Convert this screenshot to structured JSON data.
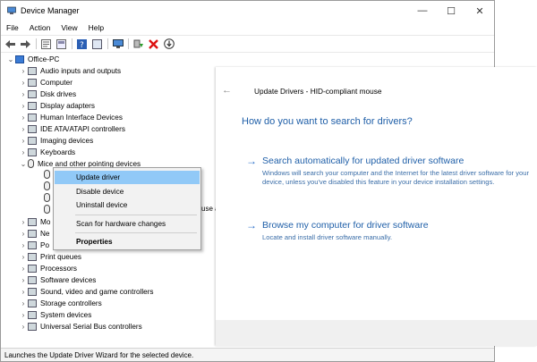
{
  "window": {
    "title": "Device Manager",
    "controls": [
      "—",
      "☐",
      "✕"
    ]
  },
  "menubar": [
    "File",
    "Action",
    "View",
    "Help"
  ],
  "toolbar_icons": [
    "back-icon",
    "forward-icon",
    "properties-icon",
    "show-hide-icon",
    "help-icon",
    "monitor-icon",
    "update-driver-icon",
    "uninstall-icon",
    "download-icon"
  ],
  "tree": {
    "root": "Office-PC",
    "items": [
      "Audio inputs and outputs",
      "Computer",
      "Disk drives",
      "Display adapters",
      "Human Interface Devices",
      "IDE ATA/ATAPI controllers",
      "Imaging devices",
      "Keyboards",
      "Mice and other pointing devices"
    ],
    "partial_rows": [
      "Mo",
      "Ne",
      "Po"
    ],
    "partial_right": "use a",
    "items_after": [
      "Print queues",
      "Processors",
      "Software devices",
      "Sound, video and game controllers",
      "Storage controllers",
      "System devices",
      "Universal Serial Bus controllers"
    ]
  },
  "context_menu": {
    "update": "Update driver",
    "disable": "Disable device",
    "uninstall": "Uninstall device",
    "scan": "Scan for hardware changes",
    "properties": "Properties"
  },
  "status": "Launches the Update Driver Wizard for the selected device.",
  "update_panel": {
    "title": "Update Drivers - HID-compliant mouse",
    "heading": "How do you want to search for drivers?",
    "option1": {
      "title": "Search automatically for updated driver software",
      "desc": "Windows will search your computer and the Internet for the latest driver software for your device, unless you've disabled this feature in your device installation settings."
    },
    "option2": {
      "title": "Browse my computer for driver software",
      "desc": "Locate and install driver software manually."
    }
  },
  "colors": {
    "accent": "#1f5fa8",
    "highlight": "#91c9f7"
  }
}
